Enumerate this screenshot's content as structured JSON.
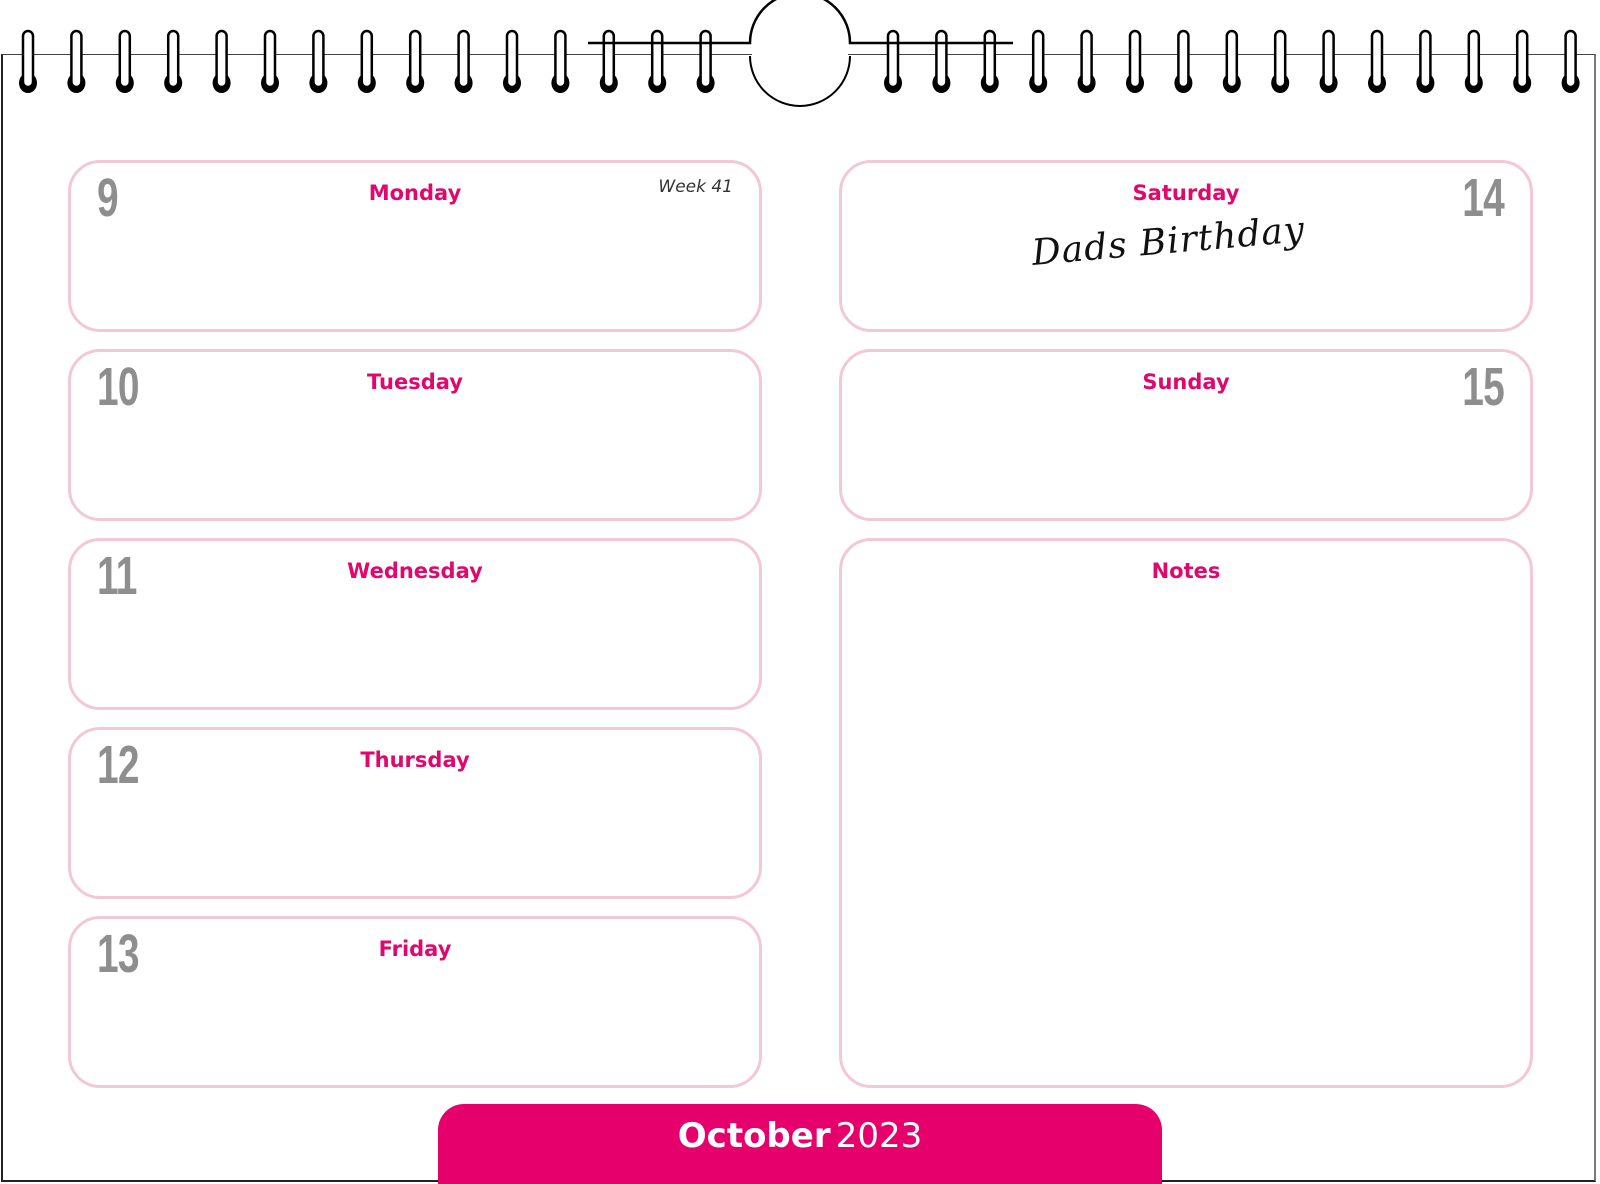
{
  "calendar": {
    "month": "October",
    "year": "2023",
    "week_label": "Week 41",
    "accent_color": "#e5006b",
    "box_border_color": "#f3c8d6",
    "left_days": [
      {
        "number": "9",
        "name": "Monday"
      },
      {
        "number": "10",
        "name": "Tuesday"
      },
      {
        "number": "11",
        "name": "Wednesday"
      },
      {
        "number": "12",
        "name": "Thursday"
      },
      {
        "number": "13",
        "name": "Friday"
      }
    ],
    "right_days": [
      {
        "number": "14",
        "name": "Saturday",
        "entry": "Dads Birthday"
      },
      {
        "number": "15",
        "name": "Sunday",
        "entry": ""
      }
    ],
    "notes_label": "Notes"
  },
  "binding": {
    "icon": "spiral-binding-icon",
    "hanger_icon": "hanger-hole-icon"
  }
}
